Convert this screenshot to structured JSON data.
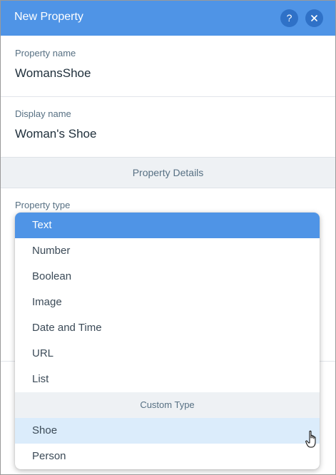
{
  "header": {
    "title": "New Property",
    "help_icon": "?",
    "close_icon": "close-icon"
  },
  "property_name": {
    "label": "Property name",
    "value": "WomansShoe"
  },
  "display_name": {
    "label": "Display name",
    "value": "Woman's Shoe"
  },
  "section": {
    "title": "Property Details"
  },
  "property_type": {
    "label": "Property type",
    "options": [
      "Text",
      "Number",
      "Boolean",
      "Image",
      "Date and Time",
      "URL",
      "List"
    ],
    "selected": "Text",
    "custom_header": "Custom Type",
    "custom_options": [
      "Shoe",
      "Person"
    ],
    "hovered": "Shoe"
  },
  "colors": {
    "accent": "#4f94e6",
    "hover": "#dbecfb",
    "header_button": "#2f71c7"
  }
}
